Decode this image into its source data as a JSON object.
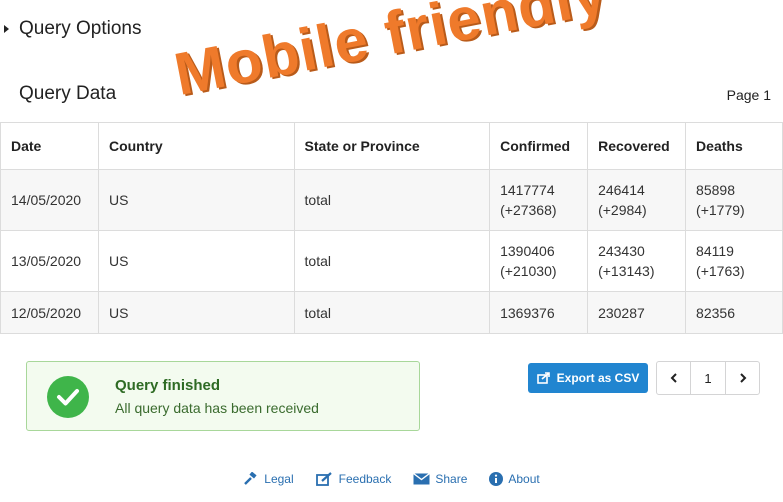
{
  "query_options": {
    "title": "Query Options"
  },
  "query_data": {
    "title": "Query Data",
    "page_label": "Page 1"
  },
  "table": {
    "headers": [
      "Date",
      "Country",
      "State or Province",
      "Confirmed",
      "Recovered",
      "Deaths"
    ],
    "rows": [
      {
        "date": "14/05/2020",
        "country": "US",
        "state": "total",
        "confirmed": "1417774",
        "confirmed_delta": "(+27368)",
        "recovered": "246414",
        "recovered_delta": "(+2984)",
        "deaths": "85898",
        "deaths_delta": "(+1779)"
      },
      {
        "date": "13/05/2020",
        "country": "US",
        "state": "total",
        "confirmed": "1390406",
        "confirmed_delta": "(+21030)",
        "recovered": "243430",
        "recovered_delta": "(+13143)",
        "deaths": "84119",
        "deaths_delta": "(+1763)"
      },
      {
        "date": "12/05/2020",
        "country": "US",
        "state": "total",
        "confirmed": "1369376",
        "recovered": "230287",
        "deaths": "82356"
      }
    ]
  },
  "status": {
    "title": "Query finished",
    "message": "All query data has been received",
    "icon": "check-circle-icon"
  },
  "export": {
    "label": "Export as CSV",
    "icon": "export-icon"
  },
  "pagination": {
    "current_page": "1",
    "prev_icon": "chevron-left-icon",
    "next_icon": "chevron-right-icon"
  },
  "footer": {
    "legal": "Legal",
    "feedback": "Feedback",
    "share": "Share",
    "about": "About"
  },
  "watermark": "Mobile friendly",
  "colors": {
    "accent": "#2185d0",
    "success": "#3fb54a",
    "watermark": "#ef7a2b",
    "link": "#2a6fb0"
  }
}
